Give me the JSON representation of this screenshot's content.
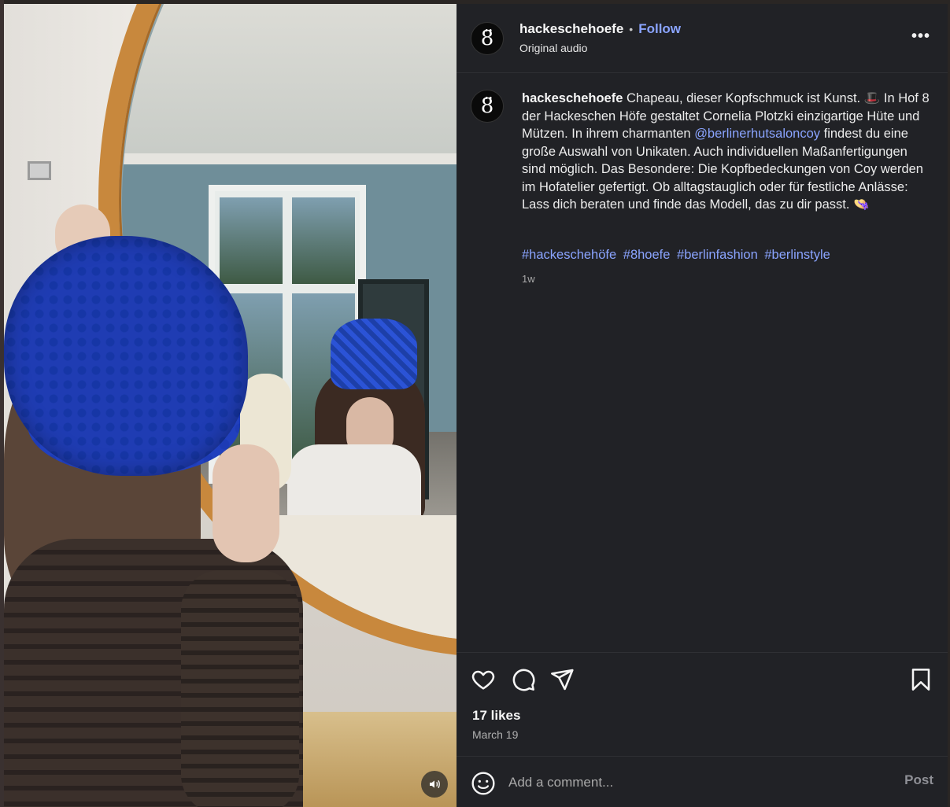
{
  "post": {
    "username": "hackeschehoefe",
    "avatar_glyph": "8̈",
    "separator": "•",
    "follow_label": "Follow",
    "audio_label": "Original audio",
    "more_label": "•••"
  },
  "caption": {
    "username": "hackeschehoefe",
    "text_part1": " Chapeau, dieser Kopfschmuck ist Kunst. 🎩 In Hof 8 der Hackeschen Höfe gestaltet Cornelia Plotzki einzigartige Hüte und Mützen. In ihrem charmanten ",
    "mention": "@berlinerhutsaloncoy",
    "text_part2": " findest du eine große Auswahl von Unikaten. Auch individuellen Maßanfertigungen sind möglich. Das Besondere: Die Kopfbedeckungen von Coy werden im Hofatelier gefertigt. Ob alltagstauglich oder für festliche Anlässe: Lass dich beraten und finde das Modell, das zu dir passt. 👒",
    "hashtags": [
      "#hackeschehöfe",
      "#8hoefe",
      "#berlinfashion",
      "#berlinstyle"
    ],
    "age": "1w"
  },
  "actions": {
    "icons": [
      "heart-icon",
      "comment-icon",
      "share-icon",
      "bookmark-icon"
    ]
  },
  "stats": {
    "likes": "17 likes",
    "date": "March 19"
  },
  "comment": {
    "placeholder": "Add a comment...",
    "post_label": "Post"
  },
  "colors": {
    "panel_bg": "#212226",
    "link_blue": "#8aa4ff",
    "hat_blue": "#1636a6",
    "mirror_frame": "#c8883d"
  }
}
